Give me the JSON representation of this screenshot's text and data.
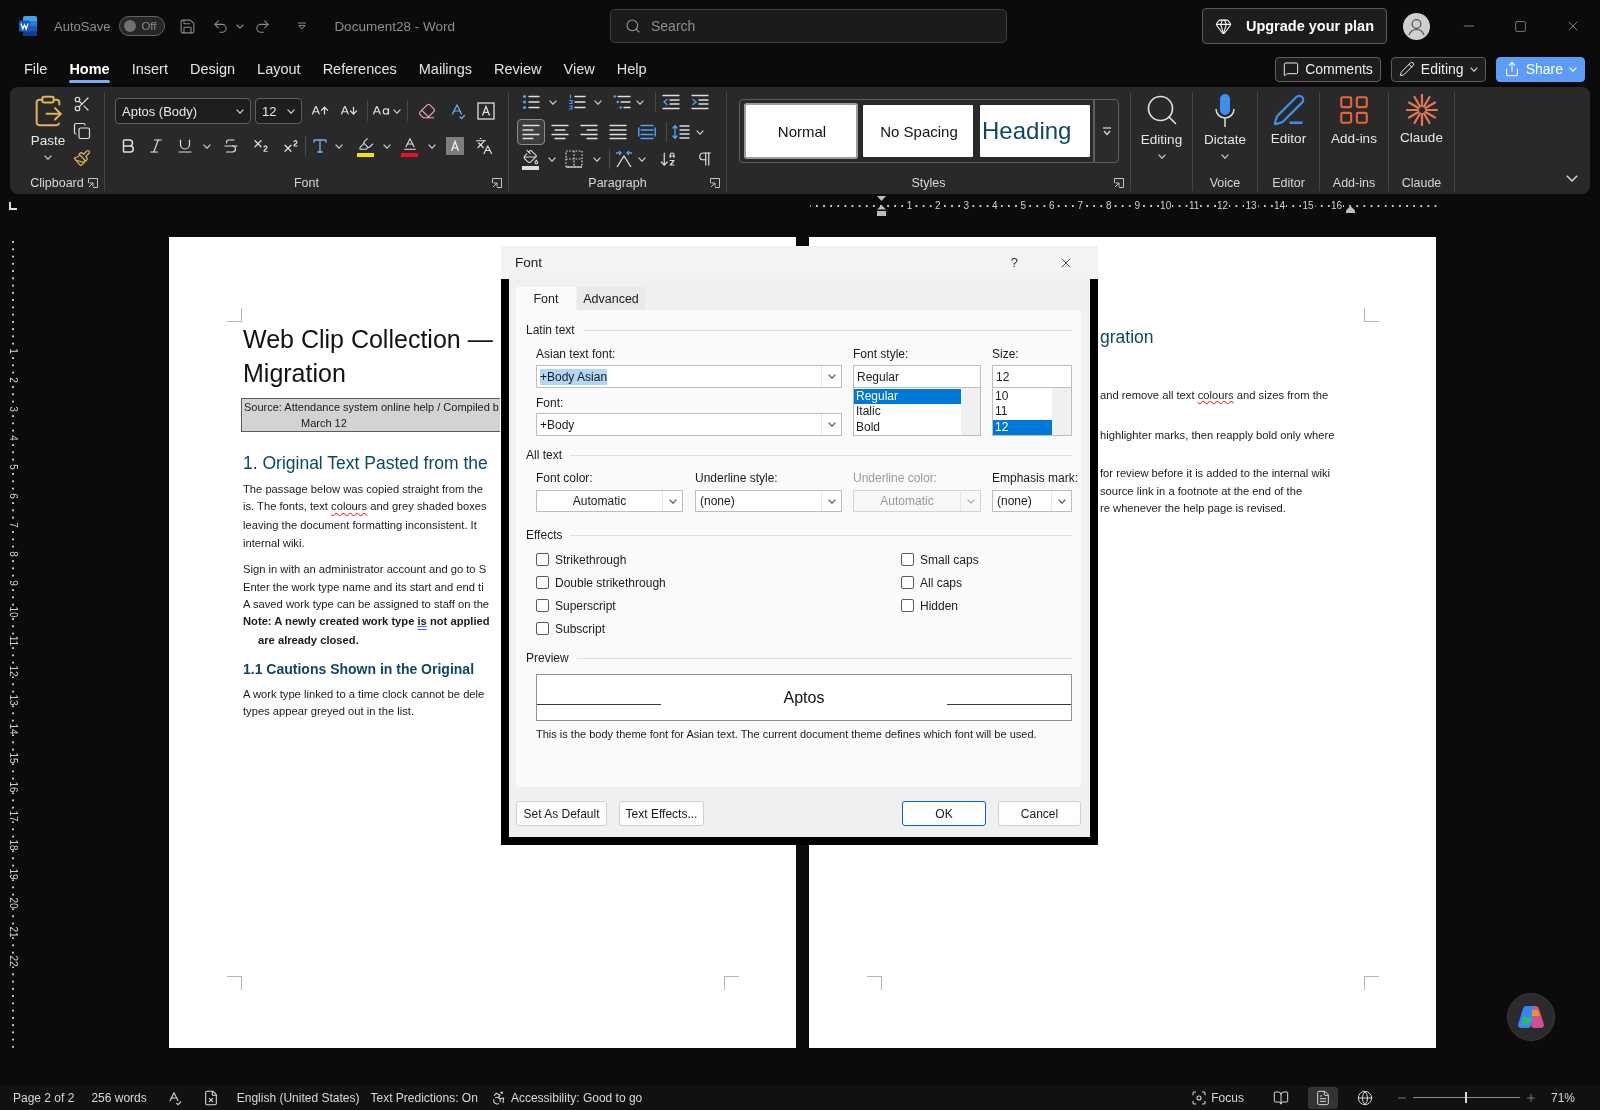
{
  "title_bar": {
    "autosave": {
      "label": "AutoSave",
      "state_text": "Off",
      "on": false
    },
    "document_title": "Document28 - Word",
    "search": {
      "placeholder": "Search"
    },
    "upgrade_button": "Upgrade your plan"
  },
  "menu": {
    "tabs": [
      {
        "label": "File",
        "selected": false
      },
      {
        "label": "Home",
        "selected": true
      },
      {
        "label": "Insert",
        "selected": false
      },
      {
        "label": "Design",
        "selected": false
      },
      {
        "label": "Layout",
        "selected": false
      },
      {
        "label": "References",
        "selected": false
      },
      {
        "label": "Mailings",
        "selected": false
      },
      {
        "label": "Review",
        "selected": false
      },
      {
        "label": "View",
        "selected": false
      },
      {
        "label": "Help",
        "selected": false
      }
    ],
    "buttons": [
      {
        "label": "Comments",
        "kind": "comments"
      },
      {
        "label": "Editing",
        "kind": "mode"
      },
      {
        "label": "Share",
        "kind": "share"
      }
    ]
  },
  "ribbon": {
    "clipboard": {
      "paste": "Paste",
      "label": "Clipboard"
    },
    "font": {
      "name": "Aptos (Body)",
      "size": "12",
      "label": "Font"
    },
    "paragraph": {
      "label": "Paragraph",
      "alignments": [
        {
          "kind": "left",
          "selected": true
        },
        {
          "kind": "center",
          "selected": false
        },
        {
          "kind": "right",
          "selected": false
        },
        {
          "kind": "justify",
          "selected": false
        },
        {
          "kind": "distributed",
          "selected": false
        }
      ]
    },
    "styles": {
      "label": "Styles",
      "items": [
        {
          "label": "Normal",
          "kind": "body",
          "selected": true
        },
        {
          "label": "No Spacing",
          "kind": "body",
          "selected": false
        },
        {
          "label": "Heading",
          "kind": "heading",
          "selected": false
        }
      ]
    },
    "commands": [
      {
        "label": "Editing",
        "kind": "find",
        "dropdown": true
      },
      {
        "label": "Dictate",
        "kind": "mic",
        "group": "Voice",
        "dropdown": true
      },
      {
        "label": "Editor",
        "kind": "pen",
        "group": "Editor",
        "dropdown": false
      },
      {
        "label": "Add-ins",
        "kind": "grid",
        "group": "Add-ins",
        "dropdown": false
      },
      {
        "label": "Claude",
        "kind": "burst",
        "group": "Claude",
        "dropdown": false
      }
    ]
  },
  "rulers": {
    "horizontal": [
      "1",
      "2",
      "3",
      "4",
      "5",
      "6",
      "7",
      "8",
      "9",
      "10",
      "11",
      "12",
      "13",
      "14",
      "15",
      "16"
    ],
    "vertical": [
      "1",
      "2",
      "3",
      "4",
      "5",
      "6",
      "7",
      "8",
      "9",
      "10",
      "11",
      "12",
      "13",
      "14",
      "15",
      "16",
      "17",
      "18",
      "19",
      "20",
      "21",
      "22"
    ]
  },
  "pages": [
    {
      "blocks": [
        {
          "kind": "title",
          "lines": [
            "Web Clip Collection —",
            "Migration"
          ]
        },
        {
          "kind": "source",
          "lines": [
            "Source: Attendance system online help / Compiled b",
            "March 12"
          ]
        },
        {
          "kind": "heading1",
          "lines": [
            "1. Original Text Pasted from the"
          ]
        },
        {
          "kind": "body",
          "lines": [
            "The passage below was copied straight from the",
            [
              {
                "text": "is. The fonts, text ",
                "misspelled": false
              },
              {
                "text": "colours",
                "misspelled": true
              },
              {
                "text": " and grey shaded boxes",
                "misspelled": false
              }
            ],
            "leaving the document formatting inconsistent. It",
            "internal wiki."
          ]
        },
        {
          "kind": "body",
          "lines": [
            "Sign in with an administrator account and go to S",
            "Enter the work type name and its start and end ti",
            "A saved work type can be assigned to staff on the"
          ]
        },
        {
          "kind": "note",
          "lines": [
            [
              {
                "text": "Note: A newly created work type ",
                "grammar_issue": false
              },
              {
                "text": "is",
                "grammar_issue": true
              },
              {
                "text": " not applied",
                "grammar_issue": false
              }
            ],
            "are already closed."
          ]
        },
        {
          "kind": "heading2",
          "lines": [
            "1.1 Cautions Shown in the Original"
          ]
        },
        {
          "kind": "body",
          "lines": [
            "A work type linked to a time clock cannot be dele",
            "types appear greyed out in the list."
          ]
        }
      ]
    },
    {
      "blocks": [
        {
          "kind": "heading1",
          "lines": [
            "gration"
          ]
        },
        {
          "kind": "body",
          "lines": [
            [
              {
                "text": "and remove all text ",
                "misspelled": false
              },
              {
                "text": "colours",
                "misspelled": true
              },
              {
                "text": " and sizes from the",
                "misspelled": false
              }
            ]
          ]
        },
        {
          "kind": "body",
          "lines": [
            "highlighter marks, then reapply bold only where"
          ]
        },
        {
          "kind": "body",
          "lines": [
            "for review before it is added to the internal wiki",
            "source link in a footnote at the end of the",
            "re whenever the help page is revised."
          ]
        }
      ]
    }
  ],
  "font_dialog": {
    "title": "Font",
    "help": "?",
    "tabs": [
      {
        "label": "Font",
        "selected": true
      },
      {
        "label": "Advanced",
        "selected": false
      }
    ],
    "latin_text": {
      "heading": "Latin text",
      "asian_font": {
        "label": "Asian text font:",
        "value": "+Body Asian",
        "highlighted": true
      },
      "font": {
        "label": "Font:",
        "value": "+Body",
        "highlighted": false
      },
      "style": {
        "label": "Font style:",
        "value": "Regular",
        "options": [
          {
            "label": "Regular",
            "selected": true
          },
          {
            "label": "Italic",
            "selected": false
          },
          {
            "label": "Bold",
            "selected": false
          }
        ]
      },
      "size": {
        "label": "Size:",
        "value": "12",
        "options": [
          {
            "label": "10",
            "selected": false
          },
          {
            "label": "11",
            "selected": false
          },
          {
            "label": "12",
            "selected": true
          }
        ]
      }
    },
    "all_text": {
      "heading": "All text",
      "fields": [
        {
          "label": "Font color:",
          "value": "Automatic",
          "kind": "color",
          "disabled": false
        },
        {
          "label": "Underline style:",
          "value": "(none)",
          "kind": "list",
          "disabled": false
        },
        {
          "label": "Underline color:",
          "value": "Automatic",
          "kind": "color",
          "disabled": true
        },
        {
          "label": "Emphasis mark:",
          "value": "(none)",
          "kind": "list",
          "disabled": false
        }
      ]
    },
    "effects": {
      "heading": "Effects",
      "columns": [
        [
          {
            "label": "Strikethrough",
            "checked": false
          },
          {
            "label": "Double strikethrough",
            "checked": false
          },
          {
            "label": "Superscript",
            "checked": false
          },
          {
            "label": "Subscript",
            "checked": false
          }
        ],
        [
          {
            "label": "Small caps",
            "checked": false
          },
          {
            "label": "All caps",
            "checked": false
          },
          {
            "label": "Hidden",
            "checked": false
          }
        ]
      ]
    },
    "preview": {
      "heading": "Preview",
      "sample": "Aptos",
      "note": "This is the body theme font for Asian text. The current document theme defines which font will be used."
    },
    "buttons": [
      [
        {
          "label": "Set As Default",
          "default": false
        },
        {
          "label": "Text Effects...",
          "default": false
        }
      ],
      [
        {
          "label": "OK",
          "default": true
        },
        {
          "label": "Cancel",
          "default": false
        }
      ]
    ]
  },
  "status_bar": {
    "page": "Page 2 of 2",
    "words": "256 words",
    "language": "English (United States)",
    "text_predictions": "Text Predictions: On",
    "accessibility": "Accessibility: Good to go",
    "focus": "Focus",
    "views": [
      {
        "kind": "read",
        "selected": false
      },
      {
        "kind": "print",
        "selected": true
      },
      {
        "kind": "web",
        "selected": false
      }
    ],
    "zoom": {
      "level": 0.5,
      "label": "71%"
    }
  }
}
